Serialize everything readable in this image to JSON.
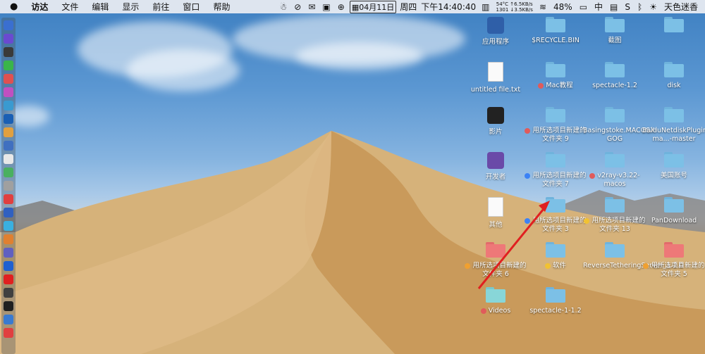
{
  "menubar": {
    "apple": "",
    "menus": [
      "访达",
      "文件",
      "编辑",
      "显示",
      "前往",
      "窗口",
      "帮助"
    ],
    "temp": "54°C",
    "upload": "↑6.5KB/s",
    "fan": "1301",
    "download": "↓3.5KB/s",
    "date": "04月11日",
    "weekday": "周四",
    "time": "下午14:40:40",
    "battery": "48%",
    "input": "中",
    "user": "天色迷香"
  },
  "desktop": {
    "icons": [
      {
        "label": "应用程序",
        "kind": "app",
        "color": "#2f5fa8"
      },
      {
        "label": "$RECYCLE.BIN",
        "kind": "folder",
        "color": "blue"
      },
      {
        "label": "截图",
        "kind": "folder",
        "color": "blue"
      },
      {
        "label": "",
        "kind": "folder",
        "color": "blue"
      },
      {
        "label": "untitled file.txt",
        "kind": "doc"
      },
      {
        "label": "Mac教程",
        "kind": "folder",
        "color": "blue",
        "tag": "#e05b5b"
      },
      {
        "label": "spectacle-1.2",
        "kind": "folder",
        "color": "blue"
      },
      {
        "label": "disk",
        "kind": "folder",
        "color": "blue"
      },
      {
        "label": "影片",
        "kind": "app",
        "color": "#222"
      },
      {
        "label": "用所选项目新建的文件夹 9",
        "kind": "folder",
        "color": "blue",
        "tag": "#e05b5b"
      },
      {
        "label": "Basingstoke.MACOSX-GOG",
        "kind": "folder",
        "color": "blue"
      },
      {
        "label": "BaiduNetdiskPlugin-ma...-master",
        "kind": "folder",
        "color": "blue"
      },
      {
        "label": "开发者",
        "kind": "app",
        "color": "#6a4aa8"
      },
      {
        "label": "用所选项目新建的文件夹 7",
        "kind": "folder",
        "color": "blue",
        "tag": "#3b82f6"
      },
      {
        "label": "v2ray-v3.22-macos",
        "kind": "folder",
        "color": "blue",
        "tag": "#e05b5b"
      },
      {
        "label": "美国账号",
        "kind": "folder",
        "color": "blue"
      },
      {
        "label": "其他",
        "kind": "doc"
      },
      {
        "label": "用所选项目新建的文件夹 3",
        "kind": "folder",
        "color": "blue",
        "tag": "#3b82f6"
      },
      {
        "label": "用所选项目新建的文件夹 13",
        "kind": "folder",
        "color": "blue",
        "tag": "#f1c232"
      },
      {
        "label": "PanDownload",
        "kind": "folder",
        "color": "blue"
      },
      {
        "label": "用所选项目新建的文件夹 6",
        "kind": "folder",
        "color": "red",
        "tag": "#f0a030"
      },
      {
        "label": "软件",
        "kind": "folder",
        "color": "blue",
        "tag": "#f1c232"
      },
      {
        "label": "ReverseTetheringServer_1.2.0",
        "kind": "folder",
        "color": "blue"
      },
      {
        "label": "用所选项目新建的文件夹 5",
        "kind": "folder",
        "color": "red",
        "tag": "#f0a030"
      },
      {
        "label": "Videos",
        "kind": "folder",
        "color": "teal",
        "tag": "#e05b5b"
      },
      {
        "label": "spectacle-1-1.2",
        "kind": "folder",
        "color": "blue"
      }
    ]
  },
  "annotation": {
    "arrow_color": "#e02020"
  }
}
